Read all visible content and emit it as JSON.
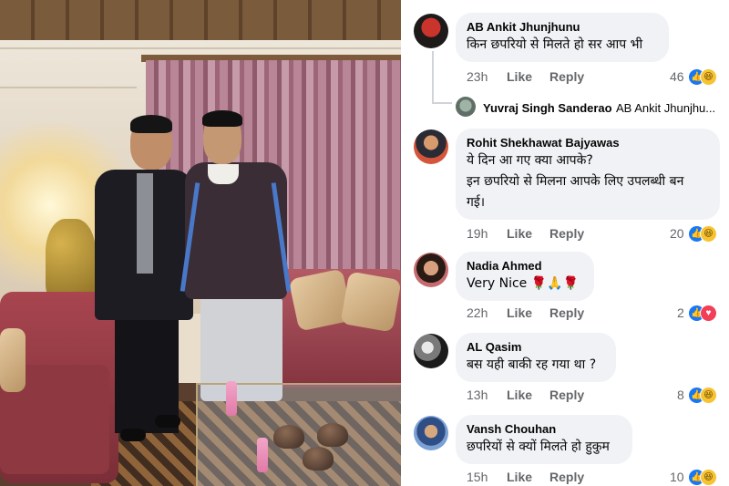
{
  "photo": {
    "description_label": "Photo of two men standing in a living room"
  },
  "comments": [
    {
      "author": "AB Ankit Jhunjhunu",
      "lines": [
        "किन छपरियो से मिलते हो सर आप भी"
      ],
      "time": "23h",
      "like_label": "Like",
      "reply_label": "Reply",
      "reaction_count": "46",
      "reactions": [
        "like-icon",
        "haha-icon"
      ]
    },
    {
      "reply_preview": {
        "author": "Yuvraj Singh Sanderao",
        "text": "AB Ankit Jhunjhu..."
      }
    },
    {
      "author": "Rohit Shekhawat Bajyawas",
      "lines": [
        "ये दिन आ गए क्या आपके?",
        "इन छपरियो से मिलना आपके लिए उपलब्धी बन",
        "गई।"
      ],
      "time": "19h",
      "like_label": "Like",
      "reply_label": "Reply",
      "reaction_count": "20",
      "reactions": [
        "like-icon",
        "haha-icon"
      ]
    },
    {
      "author": "Nadia Ahmed",
      "lines": [
        "Very Nice 🌹🙏🌹"
      ],
      "time": "22h",
      "like_label": "Like",
      "reply_label": "Reply",
      "reaction_count": "2",
      "reactions": [
        "like-icon",
        "love-icon"
      ]
    },
    {
      "author": "AL Qasim",
      "lines": [
        "बस यही बाकी रह गया था ?"
      ],
      "time": "13h",
      "like_label": "Like",
      "reply_label": "Reply",
      "reaction_count": "8",
      "reactions": [
        "like-icon",
        "haha-icon"
      ]
    },
    {
      "author": "Vansh Chouhan",
      "lines": [
        "छपरियों से क्यों मिलते हो हुकुम"
      ],
      "time": "15h",
      "like_label": "Like",
      "reply_label": "Reply",
      "reaction_count": "10",
      "reactions": [
        "like-icon",
        "haha-icon"
      ]
    }
  ],
  "colors": {
    "bubble": "#f0f2f5",
    "meta_text": "#65676b",
    "like_blue": "#1877f2",
    "haha_yellow": "#f7c332",
    "love_red": "#f33e58"
  }
}
